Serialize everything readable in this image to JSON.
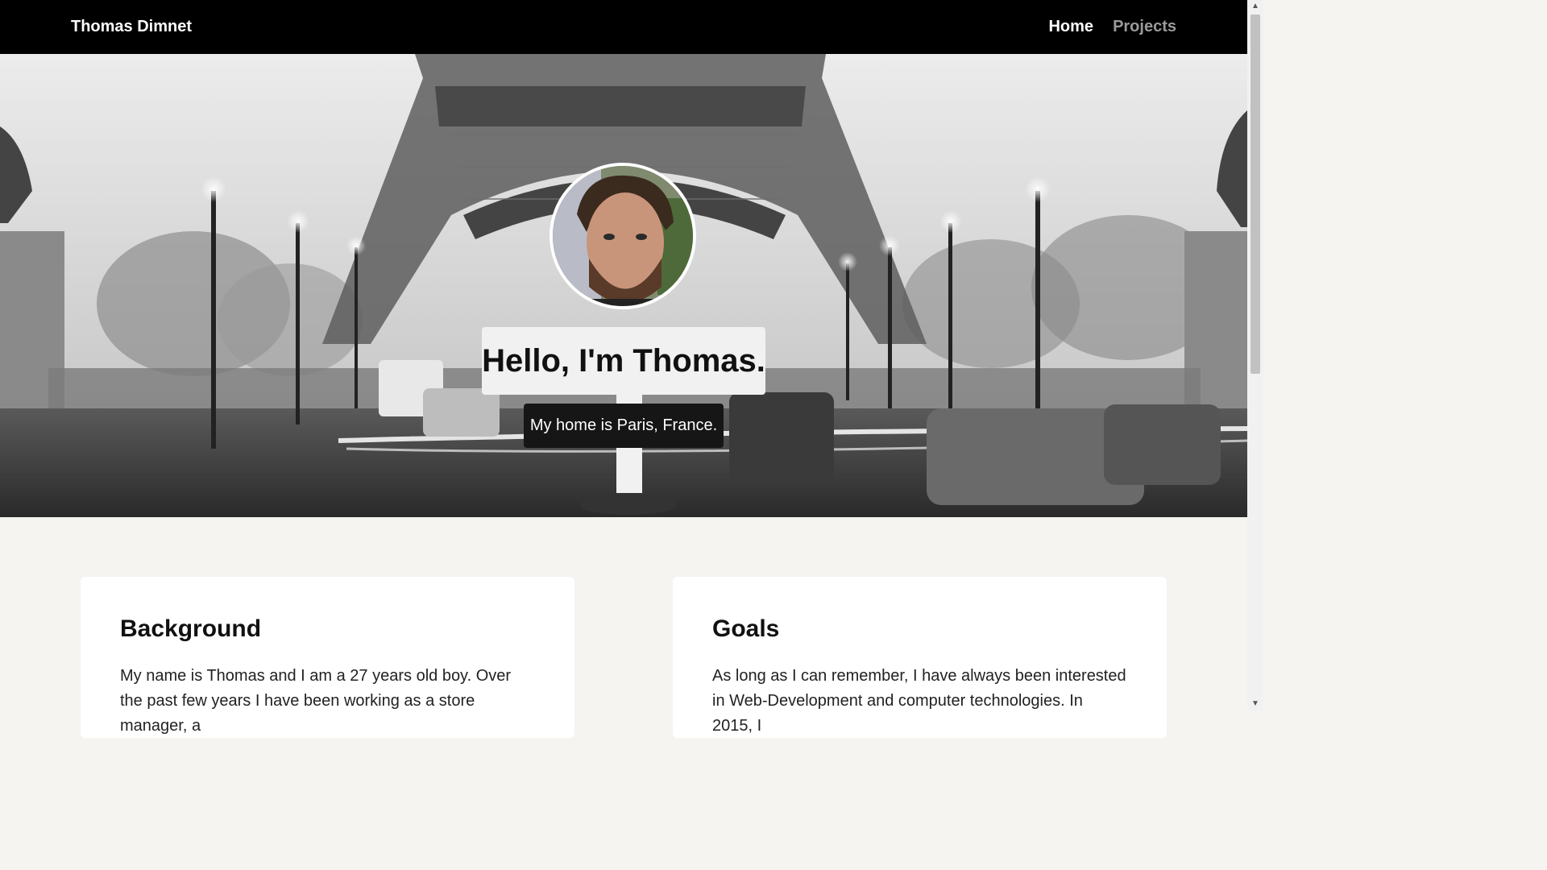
{
  "nav": {
    "brand": "Thomas Dimnet",
    "links": [
      {
        "label": "Home",
        "active": true
      },
      {
        "label": "Projects",
        "active": false
      }
    ]
  },
  "hero": {
    "greeting": "Hello, I'm Thomas.",
    "location": "My home is Paris, France."
  },
  "cards": [
    {
      "title": "Background",
      "text": "My name is Thomas and I am a 27 years old boy. Over the past few years I have been working as a store manager, a"
    },
    {
      "title": "Goals",
      "text": "As long as I can remember, I have always been interested in Web-Development and computer technologies. In 2015, I"
    }
  ],
  "icons": {
    "scroll_up": "triangle-up-icon",
    "scroll_down": "triangle-down-icon"
  },
  "colors": {
    "navbar_bg": "#000000",
    "page_bg": "#f5f4f0",
    "nav_inactive": "#9a9a9a"
  }
}
